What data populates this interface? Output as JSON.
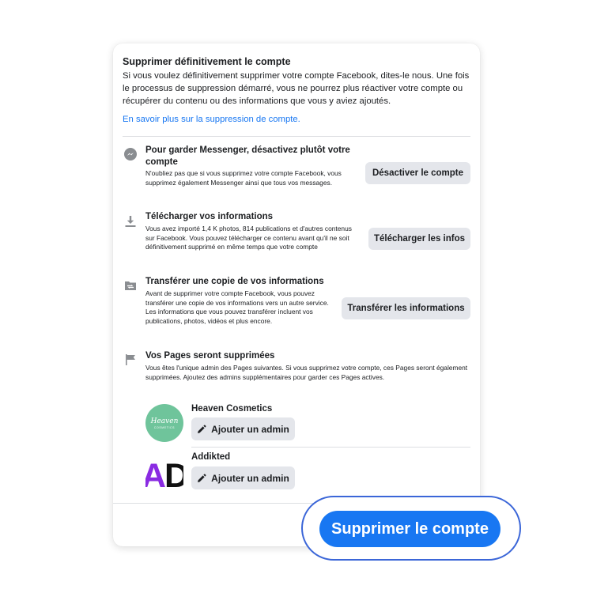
{
  "dialog": {
    "title": "Supprimer définitivement le compte",
    "intro": "Si vous voulez définitivement supprimer votre compte Facebook, dites-le nous. Une fois le processus de suppression démarré, vous ne pourrez plus réactiver votre compte ou récupérer du contenu ou des informations que vous y aviez ajoutés.",
    "learn_more": "En savoir plus sur la suppression de compte."
  },
  "sections": [
    {
      "icon": "messenger-icon",
      "title": "Pour garder Messenger, désactivez plutôt votre compte",
      "desc": "N'oubliez pas que si vous supprimez votre compte Facebook, vous supprimez également Messenger ainsi que tous vos messages.",
      "button": "Désactiver le compte"
    },
    {
      "icon": "download-icon",
      "title": "Télécharger vos informations",
      "desc": "Vous avez importé 1,4 K photos, 814 publications et d'autres contenus sur Facebook. Vous pouvez télécharger ce contenu avant qu'il ne soit définitivement supprimé en même temps que votre compte",
      "button": "Télécharger les infos"
    },
    {
      "icon": "folder-transfer-icon",
      "title": "Transférer une copie de vos informations",
      "desc": "Avant de supprimer votre compte Facebook, vous pouvez transférer une copie de vos informations vers un autre service. Les informations que vous pouvez transférer incluent vos publications, photos, vidéos et plus encore.",
      "button": "Transférer les informations"
    },
    {
      "icon": "flag-icon",
      "title": "Vos Pages seront supprimées",
      "desc": "Vous êtes l'unique admin des Pages suivantes. Si vous supprimez votre compte, ces Pages seront également supprimées. Ajoutez des admins supplémentaires pour garder ces Pages actives."
    }
  ],
  "pages": [
    {
      "name": "Heaven Cosmetics",
      "logo_text": "Heaven",
      "logo_sub": "COSMETICS",
      "admin_button": "Ajouter un admin"
    },
    {
      "name": "Addikted",
      "logo_text": "AD",
      "admin_button": "Ajouter un admin"
    }
  ],
  "footer": {
    "delete_button": "Supprimer le compte"
  },
  "colors": {
    "accent": "#1877f2",
    "highlight_ring": "#3b66d8",
    "button_bg": "#e4e6eb",
    "heaven_green": "#6fc49b",
    "addikted_purple": "#8a2be2"
  }
}
